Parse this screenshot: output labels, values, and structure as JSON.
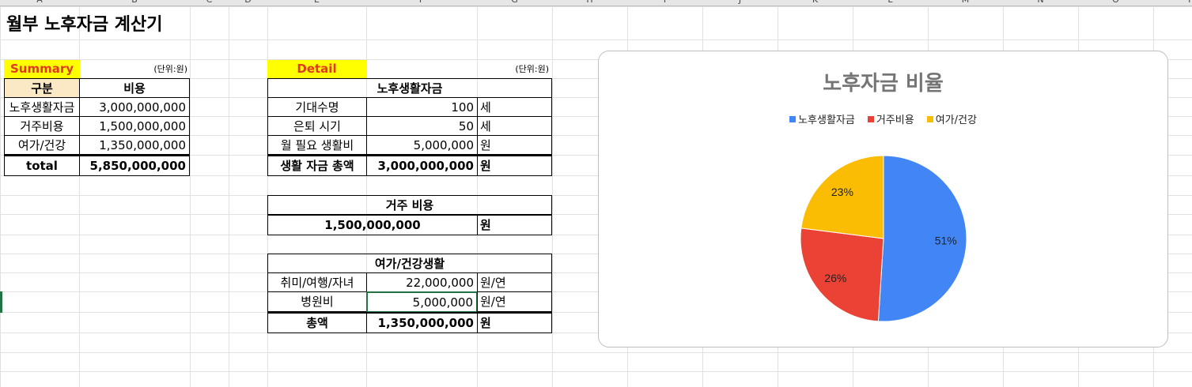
{
  "columns": [
    "A",
    "B",
    "C",
    "D",
    "E",
    "F",
    "G",
    "H",
    "I",
    "J",
    "K",
    "L",
    "M",
    "N",
    "O",
    "P"
  ],
  "title": "월부 노후자금 계산기",
  "summary": {
    "header": "Summary",
    "unit_note": "(단위:원)",
    "col1": "구분",
    "col2": "비용",
    "rows": [
      {
        "label": "노후생활자금",
        "value": "3,000,000,000"
      },
      {
        "label": "거주비용",
        "value": "1,500,000,000"
      },
      {
        "label": "여가/건강",
        "value": "1,350,000,000"
      }
    ],
    "total_label": "total",
    "total_value": "5,850,000,000"
  },
  "detail": {
    "header": "Detail",
    "unit_note": "(단위:원)",
    "living": {
      "title": "노후생활자금",
      "rows": [
        {
          "label": "기대수명",
          "value": "100",
          "unit": "세"
        },
        {
          "label": "은퇴 시기",
          "value": "50",
          "unit": "세"
        },
        {
          "label": "월 필요 생활비",
          "value": "5,000,000",
          "unit": "원"
        }
      ],
      "total_label": "생활 자금 총액",
      "total_value": "3,000,000,000",
      "total_unit": "원"
    },
    "housing": {
      "title": "거주 비용",
      "value": "1,500,000,000",
      "unit": "원"
    },
    "leisure": {
      "title": "여가/건강생활",
      "rows": [
        {
          "label": "취미/여행/자녀",
          "value": "22,000,000",
          "unit": "원/연"
        },
        {
          "label": "병원비",
          "value": "5,000,000",
          "unit": "원/연"
        }
      ],
      "total_label": "총액",
      "total_value": "1,350,000,000",
      "total_unit": "원"
    }
  },
  "chart_data": {
    "type": "pie",
    "title": "노후자금 비율",
    "categories": [
      "노후생활자금",
      "거주비용",
      "여가/건강"
    ],
    "values": [
      51,
      26,
      23
    ],
    "labels": [
      "51%",
      "26%",
      "23%"
    ],
    "colors": [
      "#4285f4",
      "#ea4335",
      "#fbbc04"
    ],
    "legend": "top"
  }
}
